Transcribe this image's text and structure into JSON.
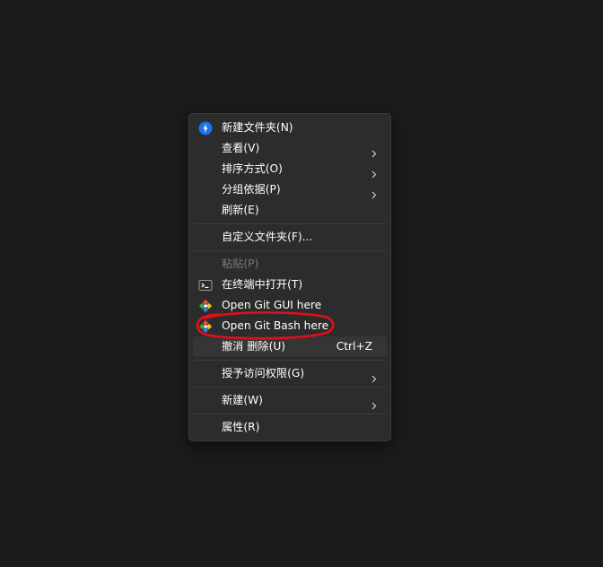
{
  "colors": {
    "desktop_bg": "#1b1b1b",
    "menu_bg": "#2c2c2c",
    "menu_border": "#3c3c3c",
    "separator": "#3d3d3d",
    "text": "#ffffff",
    "disabled_text": "#7a7a7a",
    "hover_bg": "#353535",
    "annotation_red": "#e0101a",
    "new_folder_icon": "#1a73e8"
  },
  "context_menu": {
    "new_folder": {
      "label": "新建文件夹(N)",
      "icon": "new-folder-icon"
    },
    "view": {
      "label": "查看(V)",
      "has_submenu": true
    },
    "sort": {
      "label": "排序方式(O)",
      "has_submenu": true
    },
    "group": {
      "label": "分组依据(P)",
      "has_submenu": true
    },
    "refresh": {
      "label": "刷新(E)"
    },
    "customize_folder": {
      "label": "自定义文件夹(F)..."
    },
    "paste": {
      "label": "粘贴(P)",
      "disabled": true
    },
    "open_terminal": {
      "label": "在终端中打开(T)",
      "icon": "terminal-icon"
    },
    "git_gui": {
      "label": "Open Git GUI here",
      "icon": "git-icon"
    },
    "git_bash": {
      "label": "Open Git Bash here",
      "icon": "git-icon",
      "annotated": true
    },
    "undo_delete": {
      "label": "撤消 删除(U)",
      "shortcut": "Ctrl+Z",
      "hovered": true
    },
    "grant_access": {
      "label": "授予访问权限(G)",
      "has_submenu": true
    },
    "new": {
      "label": "新建(W)",
      "has_submenu": true
    },
    "properties": {
      "label": "属性(R)"
    }
  }
}
